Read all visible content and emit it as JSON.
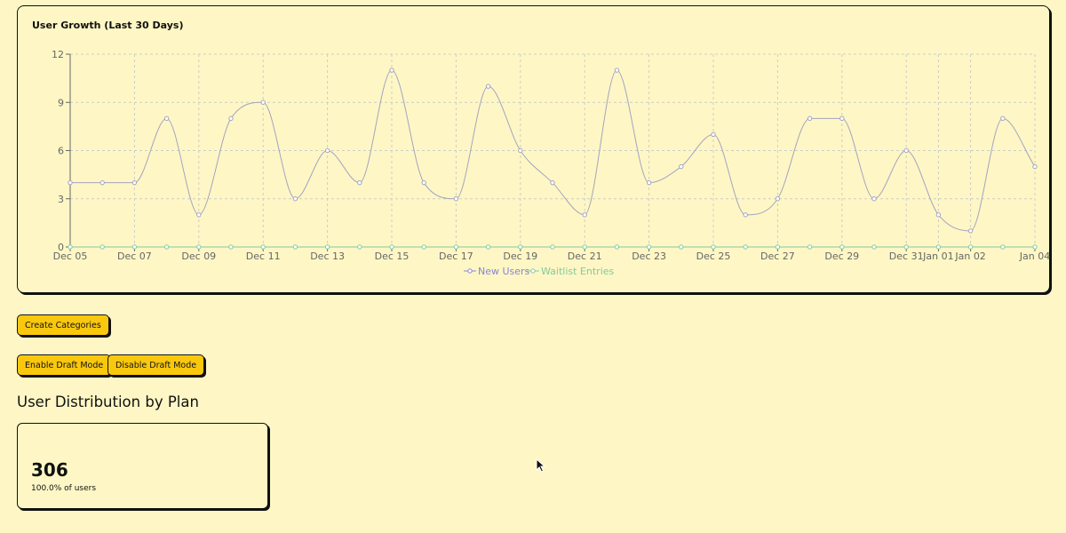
{
  "card": {
    "title": "User Growth (Last 30 Days)"
  },
  "colors": {
    "background": "#fef7c5",
    "button": "#f9c80e",
    "new_users": "#8884d8",
    "waitlist": "#82ca9d"
  },
  "chart_data": {
    "type": "line",
    "title": "User Growth (Last 30 Days)",
    "x": [
      "Dec 05",
      "Dec 06",
      "Dec 07",
      "Dec 08",
      "Dec 09",
      "Dec 10",
      "Dec 11",
      "Dec 12",
      "Dec 13",
      "Dec 14",
      "Dec 15",
      "Dec 16",
      "Dec 17",
      "Dec 18",
      "Dec 19",
      "Dec 20",
      "Dec 21",
      "Dec 22",
      "Dec 23",
      "Dec 24",
      "Dec 25",
      "Dec 26",
      "Dec 27",
      "Dec 28",
      "Dec 29",
      "Dec 30",
      "Dec 31",
      "Jan 01",
      "Jan 02",
      "Jan 03",
      "Jan 04"
    ],
    "x_tick_labels": [
      "Dec 05",
      "Dec 07",
      "Dec 09",
      "Dec 11",
      "Dec 13",
      "Dec 15",
      "Dec 17",
      "Dec 19",
      "Dec 21",
      "Dec 23",
      "Dec 25",
      "Dec 27",
      "Dec 29",
      "Dec 31",
      "Jan 01",
      "Jan 02",
      "Jan 04"
    ],
    "y_ticks": [
      0,
      3,
      6,
      9,
      12
    ],
    "ylim": [
      0,
      12
    ],
    "grid": true,
    "legend_position": "bottom",
    "curve": "smooth",
    "series": [
      {
        "name": "New Users",
        "color": "#8884d8",
        "values": [
          4,
          4,
          4,
          8,
          2,
          8,
          9,
          3,
          6,
          4,
          11,
          4,
          3,
          10,
          6,
          4,
          2,
          11,
          4,
          5,
          7,
          2,
          3,
          8,
          8,
          3,
          6,
          2,
          1,
          8,
          5
        ]
      },
      {
        "name": "Waitlist Entries",
        "color": "#82ca9d",
        "values": [
          0,
          0,
          0,
          0,
          0,
          0,
          0,
          0,
          0,
          0,
          0,
          0,
          0,
          0,
          0,
          0,
          0,
          0,
          0,
          0,
          0,
          0,
          0,
          0,
          0,
          0,
          0,
          0,
          0,
          0,
          0
        ]
      }
    ]
  },
  "buttons": {
    "create_categories": "Create Categories",
    "enable_draft": "Enable Draft Mode",
    "disable_draft": "Disable Draft Mode"
  },
  "distribution": {
    "heading": "User Distribution by Plan",
    "value": "306",
    "subtitle": "100.0% of users"
  }
}
